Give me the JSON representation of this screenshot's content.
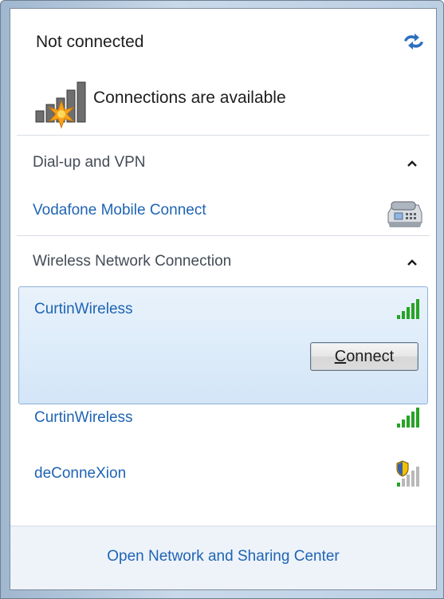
{
  "status": {
    "title": "Not connected",
    "subtitle": "Connections are available"
  },
  "sections": {
    "dialup": {
      "title": "Dial-up and VPN",
      "items": [
        {
          "name": "Vodafone Mobile Connect",
          "icon": "modem-phone-icon"
        }
      ]
    },
    "wireless": {
      "title": "Wireless Network Connection",
      "items": [
        {
          "name": "CurtinWireless",
          "icon": "signal-strength-icon",
          "signal_bars": 5,
          "selected": true,
          "action_label": "Connect",
          "action_accesskey": "C",
          "action_rest": "onnect"
        },
        {
          "name": "CurtinWireless",
          "icon": "signal-strength-icon",
          "signal_bars": 5
        },
        {
          "name": "deConneXion",
          "icon": "secured-signal-icon",
          "signal_bars": 1,
          "secured": true
        }
      ]
    }
  },
  "footer": {
    "link": "Open Network and Sharing Center"
  },
  "colors": {
    "link": "#1e64b4",
    "signal_green": "#27a327",
    "selection_border": "#8fb2d8"
  }
}
